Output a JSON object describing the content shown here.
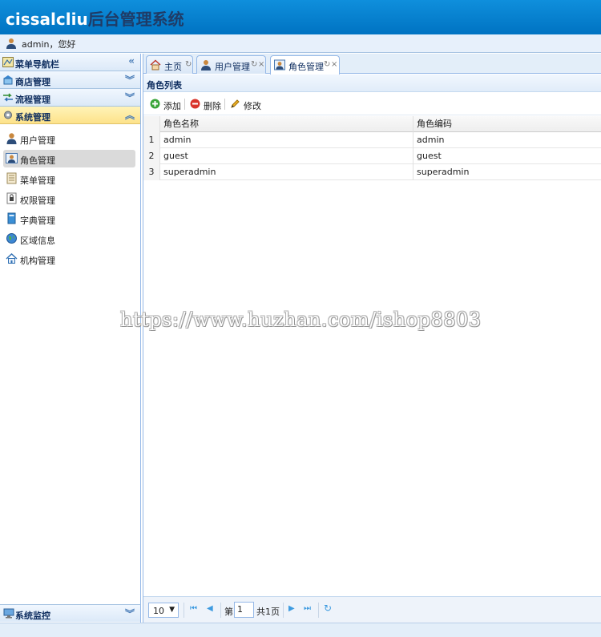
{
  "header": {
    "brand_en": "cissalcliu",
    "brand_cn": "后台管理系统",
    "user_text": "admin，您好"
  },
  "sidebar": {
    "nav_title": "菜单导航栏",
    "sections": [
      {
        "label": "商店管理",
        "arrow": "︾"
      },
      {
        "label": "流程管理",
        "arrow": "︾"
      },
      {
        "label": "系统管理",
        "arrow": "︽"
      }
    ],
    "nav_arrow": "«",
    "items": [
      {
        "label": "用户管理"
      },
      {
        "label": "角色管理"
      },
      {
        "label": "菜单管理"
      },
      {
        "label": "权限管理"
      },
      {
        "label": "字典管理"
      },
      {
        "label": "区域信息"
      },
      {
        "label": "机构管理"
      }
    ],
    "footer_label": "系统监控",
    "footer_arrow": "︾"
  },
  "tabs": [
    {
      "label": "主页",
      "refresh": "↻",
      "close": ""
    },
    {
      "label": "用户管理",
      "refresh": "↻",
      "close": "×"
    },
    {
      "label": "角色管理",
      "refresh": "↻",
      "close": "×"
    }
  ],
  "panel": {
    "title": "角色列表"
  },
  "toolbar": {
    "add": "添加",
    "delete": "删除",
    "edit": "修改"
  },
  "grid": {
    "columns": [
      "角色名称",
      "角色编码"
    ],
    "rows": [
      {
        "num": "1",
        "name": "admin",
        "code": "admin"
      },
      {
        "num": "2",
        "name": "guest",
        "code": "guest"
      },
      {
        "num": "3",
        "name": "superadmin",
        "code": "superadmin"
      }
    ]
  },
  "pager": {
    "page_size": "10",
    "page_size_caret": "▼",
    "prefix": "第",
    "current_page": "1",
    "suffix": "共1页",
    "first": "⏮",
    "prev": "◀",
    "next": "▶",
    "last": "⏭",
    "refresh": "↻"
  },
  "watermark": "https://www.huzhan.com/ishop8803",
  "colors": {
    "header_blue": "#0073c2",
    "brand_dark": "#1f3b66",
    "border_blue": "#95b8e7",
    "active_yellow": "#fde28a"
  }
}
